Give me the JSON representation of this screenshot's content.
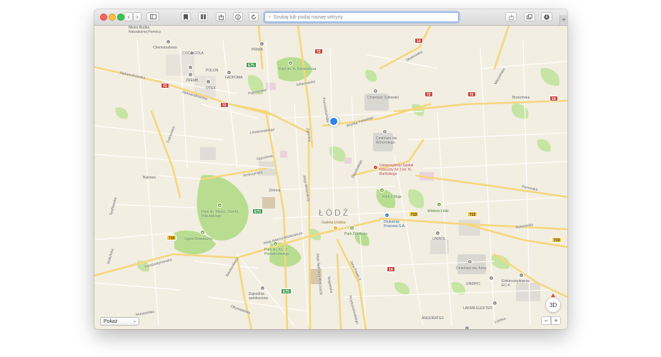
{
  "browser": {
    "address_placeholder": "Szukaj lub podaj nazwę witryny",
    "icons": [
      "back-icon",
      "forward-icon",
      "sidebar-icon",
      "bookmark-icon",
      "reading-list-icon",
      "share-icon",
      "info-icon",
      "reload-icon",
      "upload-icon",
      "tabs-icon",
      "download-icon"
    ],
    "plus": "+"
  },
  "map": {
    "city_label": "ŁÓDŹ",
    "parks": {
      "mickiewicza": "Park im. A. Mickiewicza",
      "pilsudskiego": "Park im. Marsz. Józefa Piłsudskiego",
      "botaniczny": "Ogród Botaniczny",
      "poniatowskiego": "Park im. Ks. J. Poniatowskiego",
      "trzeciego_maja": "Park 3 Maja",
      "zrodliska": "Park Źródliska"
    },
    "places": {
      "cmentarz_zydowski": "Cmentarz Żydowski",
      "cmentarz_wincentego": "Cmentarz św. Wincentego",
      "szpital": "Uniwersytecki Szpital Kliniczny Nr 1 im. N. Barlickiego",
      "widzew": "Widzew Łódź",
      "drukarnia": "Drukarnia Prasowa S.A.",
      "galeria": "Galeria Łódzka",
      "unirol": "UNIROL",
      "unidro": "UNIDRO",
      "cmentarz_anny": "Cmentarz św. Anny",
      "elektrocieplownia": "Elektrociepłownia EC-4",
      "lakma": "LAKMA ELEKTER",
      "angoratex": "ANGORATEX",
      "coca_cola": "COCA-COLA",
      "chemobudowa": "Chemobudowa",
      "polon": "POLON",
      "zremb": "ZREMB",
      "otex": "OTEX",
      "fadpoma": "FADPOMA",
      "prima": "PRIMA",
      "zajezdnia": "Zajezdnia autobusowa",
      "mleko": "Mleko-Budka Niezależnej Pomocy"
    },
    "streets": {
      "aleksandrowska_1": "Aleksandrowska",
      "aleksandrowska_2": "Aleksandrowska",
      "strykowska": "Strykowska",
      "brzezinska": "Brzezińska",
      "wojska_polskiego": "Wojska Polskiego",
      "pomorska": "Pomorska",
      "rokicinska": "Rokicińska",
      "mickiewicza": "Aleja Adama Mickiewicza",
      "wlokniarzy": "Aleja Włókniarzy",
      "kosciuszki": "Aleja Tadeusza Kościuszki",
      "zgierska": "Zgierska",
      "limanowskiego": "Limanowskiego",
      "ogrodowa": "Ogrodowa",
      "zielona": "Zielona",
      "srebrzynska": "Srebrzyńska",
      "konstantynowska": "Konstantynowska",
      "jana_pawla": "Jana Pawła II",
      "rzgowska": "Rzgowska",
      "pilsudskiego": "Piłsudskiego",
      "przybyszewskiego": "Przybyszewskiego",
      "franciszkanska": "Franciszkańska",
      "teofilowska": "Teofilowska",
      "traktorowa": "Traktorowa",
      "bandurskiego": "Bandurskiego",
      "retkinska": "Retkińska",
      "maratonska": "Maratońska",
      "obywatelska": "Obywatelska",
      "pojezierska": "Pojezierska",
      "julianowska": "Julianowska",
      "marysinska": "Marysińska",
      "bukowa": "Bukowa",
      "lodzka": "Łódzka"
    },
    "shields": {
      "s72a": "72",
      "s72b": "72",
      "s72c": "72",
      "s72d": "72",
      "s72e": "72",
      "s14a": "14",
      "s14b": "14",
      "s14c": "14",
      "s713a": "713",
      "s713b": "713",
      "s713c": "713",
      "s710": "710",
      "e75a": "E75",
      "e75b": "E75",
      "e75c": "E75"
    }
  },
  "controls": {
    "show_label": "Pokaż",
    "chevron": "⌄",
    "three_d": "3D",
    "zoom_out": "−",
    "zoom_in": "+"
  }
}
